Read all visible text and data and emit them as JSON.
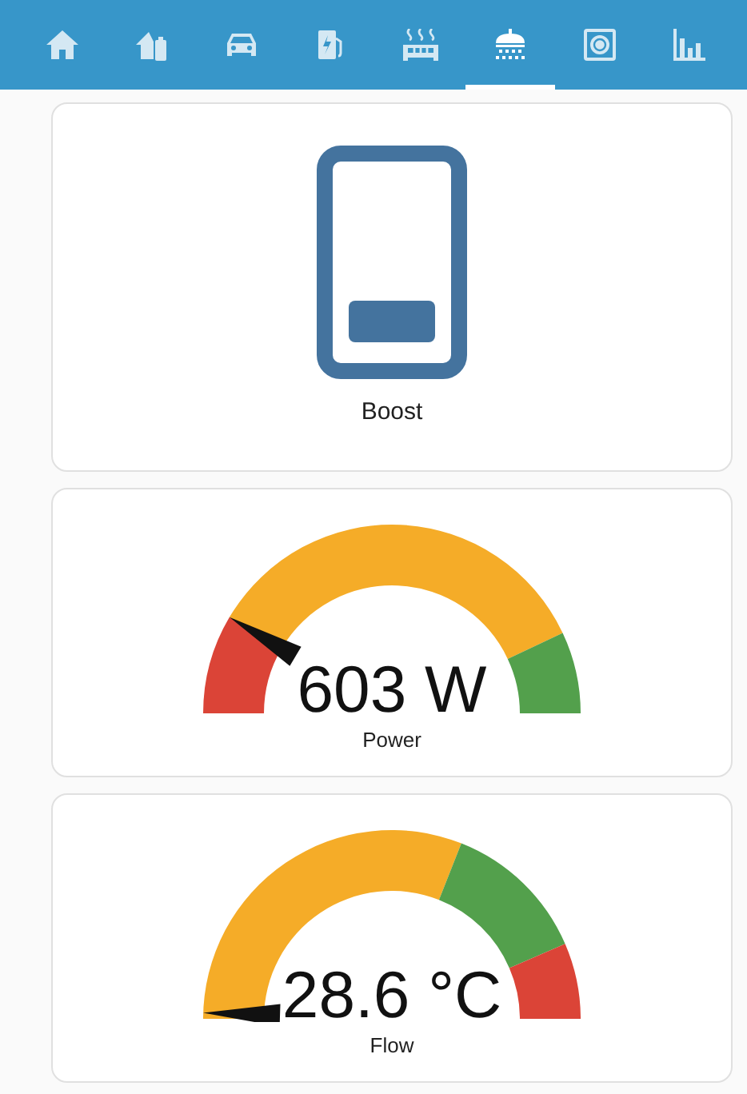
{
  "tabs": [
    {
      "selected": false
    },
    {
      "selected": false
    },
    {
      "selected": false
    },
    {
      "selected": false
    },
    {
      "selected": false
    },
    {
      "selected": true
    },
    {
      "selected": false
    },
    {
      "selected": false
    }
  ],
  "boost_card": {
    "label": "Boost",
    "on": true
  },
  "gauges": [
    {
      "value": "603 W",
      "name": "Power",
      "segments": [
        {
          "color": "#db4437"
        },
        {
          "color": "#f5ac28"
        },
        {
          "color": "#53a04c"
        }
      ]
    },
    {
      "value": "28.6 °C",
      "name": "Flow",
      "segments": [
        {
          "color": "#f5ac28"
        },
        {
          "color": "#53a04c"
        },
        {
          "color": "#db4437"
        }
      ]
    }
  ]
}
